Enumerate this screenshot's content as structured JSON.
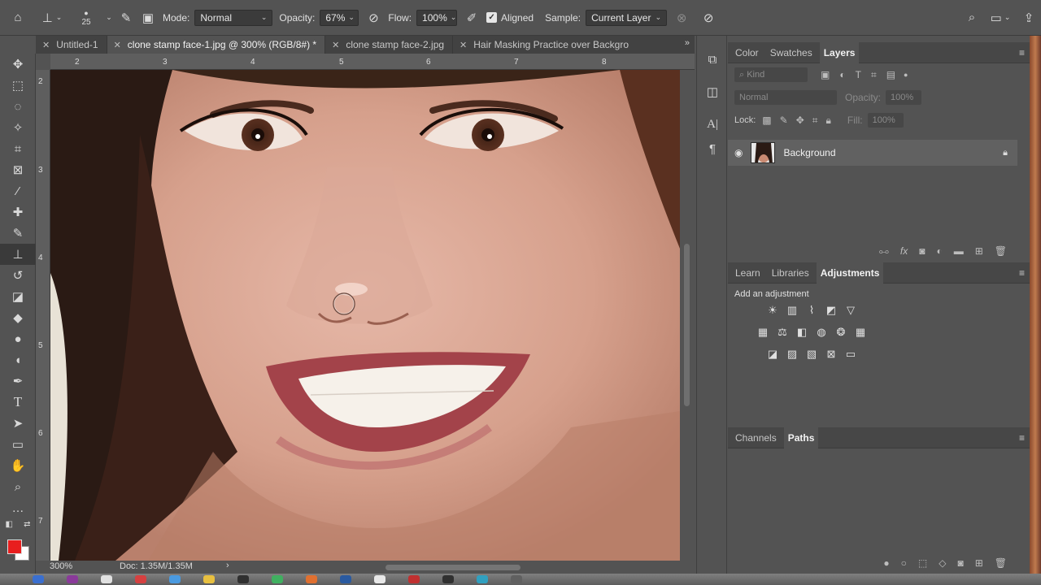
{
  "options_bar": {
    "brush_size": "25",
    "mode_label": "Mode:",
    "mode_value": "Normal",
    "opacity_label": "Opacity:",
    "opacity_value": "67%",
    "flow_label": "Flow:",
    "flow_value": "100%",
    "aligned_label": "Aligned",
    "sample_label": "Sample:",
    "sample_value": "Current Layer"
  },
  "tabs": [
    {
      "label": "Untitled-1",
      "active": false
    },
    {
      "label": "clone stamp face-1.jpg @ 300% (RGB/8#) *",
      "active": true
    },
    {
      "label": "clone stamp face-2.jpg",
      "active": false
    },
    {
      "label": "Hair Masking Practice over Backgro",
      "active": false
    }
  ],
  "rulers": {
    "top": [
      "2",
      "3",
      "4",
      "5",
      "6",
      "7",
      "8"
    ],
    "left": [
      "2",
      "3",
      "4",
      "5",
      "6",
      "7"
    ]
  },
  "status": {
    "zoom": "300%",
    "doc": "Doc: 1.35M/1.35M"
  },
  "layers_panel": {
    "tabs": [
      "Color",
      "Swatches",
      "Layers"
    ],
    "active_tab": "Layers",
    "kind_placeholder": "Kind",
    "blend_mode": "Normal",
    "opacity_label": "Opacity:",
    "opacity_value": "100%",
    "lock_label": "Lock:",
    "fill_label": "Fill:",
    "fill_value": "100%",
    "layers": [
      {
        "name": "Background",
        "visible": true,
        "locked": true
      }
    ]
  },
  "adjustments_panel": {
    "tabs": [
      "Learn",
      "Libraries",
      "Adjustments"
    ],
    "active_tab": "Adjustments",
    "hint": "Add an adjustment"
  },
  "channels_panel": {
    "tabs": [
      "Channels",
      "Paths"
    ],
    "active_tab": "Paths"
  },
  "colors": {
    "foreground": "#e81e1e",
    "background": "#ffffff",
    "ui_bg": "#535353"
  }
}
